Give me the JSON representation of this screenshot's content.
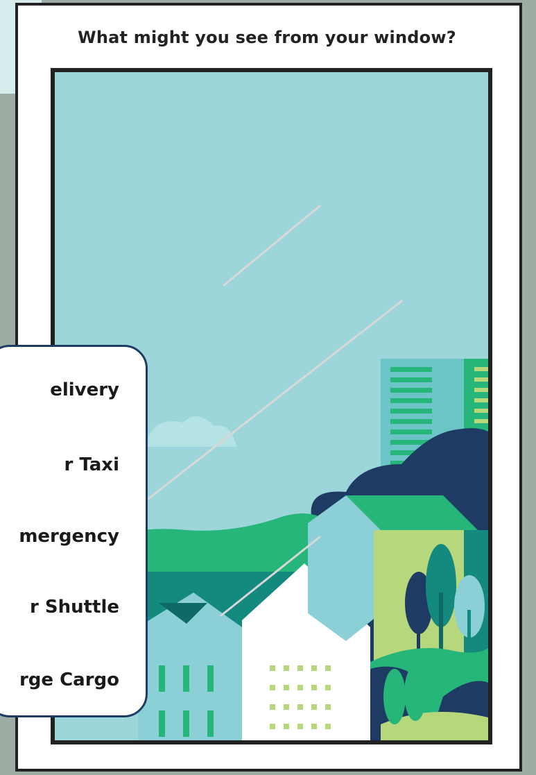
{
  "prompt": "What might you see from your window?",
  "options": [
    {
      "label": "elivery"
    },
    {
      "label": "r Taxi"
    },
    {
      "label": "mergency"
    },
    {
      "label": "r Shuttle"
    },
    {
      "label": "rge Cargo"
    }
  ],
  "colors": {
    "sky": "#9cd6db",
    "dark_navy": "#1d3b63",
    "green": "#27b67a",
    "teal": "#148a7f",
    "light_green": "#b7d77c",
    "white_house": "#ffffff",
    "light_teal_house": "#8bd0d6"
  }
}
